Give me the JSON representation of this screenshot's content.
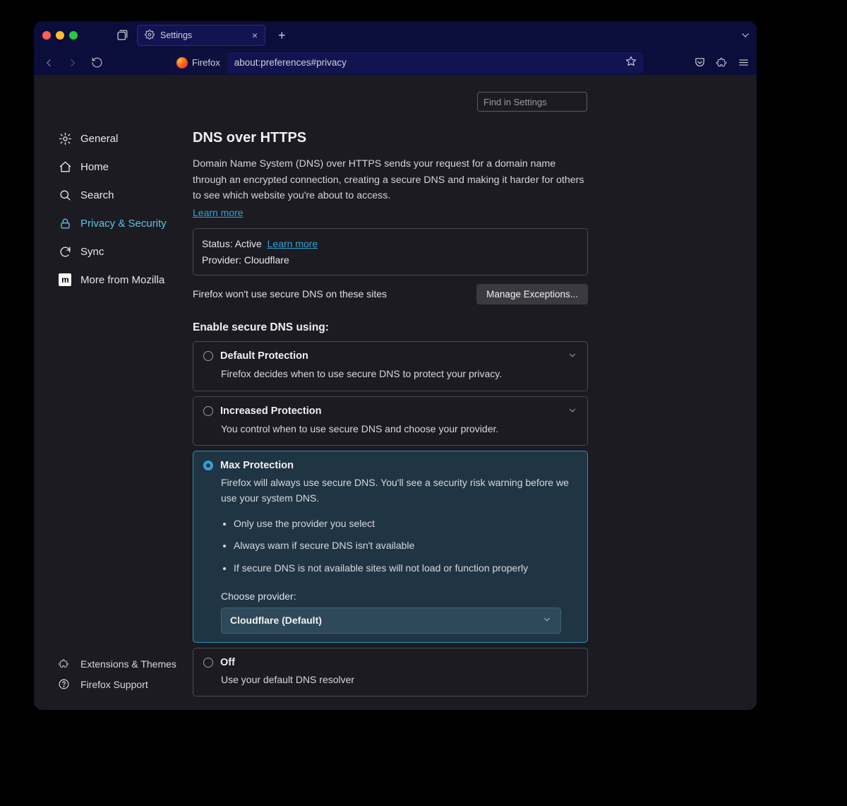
{
  "window": {
    "tab_title": "Settings",
    "identity_label": "Firefox",
    "url": "about:preferences#privacy"
  },
  "sidebar": {
    "items": [
      {
        "label": "General"
      },
      {
        "label": "Home"
      },
      {
        "label": "Search"
      },
      {
        "label": "Privacy & Security"
      },
      {
        "label": "Sync"
      },
      {
        "label": "More from Mozilla"
      }
    ],
    "footer": {
      "extensions": "Extensions & Themes",
      "support": "Firefox Support"
    }
  },
  "search": {
    "placeholder": "Find in Settings"
  },
  "doh": {
    "heading": "DNS over HTTPS",
    "description": "Domain Name System (DNS) over HTTPS sends your request for a domain name through an encrypted connection, creating a secure DNS and making it harder for others to see which website you're about to access.",
    "learn_more": "Learn more",
    "status_label": "Status:",
    "status_value": "Active",
    "status_learn_more": "Learn more",
    "provider_label": "Provider:",
    "provider_value": "Cloudflare",
    "exceptions_text": "Firefox won't use secure DNS on these sites",
    "manage_exceptions": "Manage Exceptions...",
    "enable_heading": "Enable secure DNS using:",
    "options": {
      "default": {
        "title": "Default Protection",
        "desc": "Firefox decides when to use secure DNS to protect your privacy."
      },
      "increased": {
        "title": "Increased Protection",
        "desc": "You control when to use secure DNS and choose your provider."
      },
      "max": {
        "title": "Max Protection",
        "desc": "Firefox will always use secure DNS. You'll see a security risk warning before we use your system DNS.",
        "bullet1": "Only use the provider you select",
        "bullet2": "Always warn if secure DNS isn't available",
        "bullet3": "If secure DNS is not available sites will not load or function properly",
        "choose_label": "Choose provider:",
        "selected_provider": "Cloudflare (Default)"
      },
      "off": {
        "title": "Off",
        "desc": "Use your default DNS resolver"
      }
    }
  }
}
